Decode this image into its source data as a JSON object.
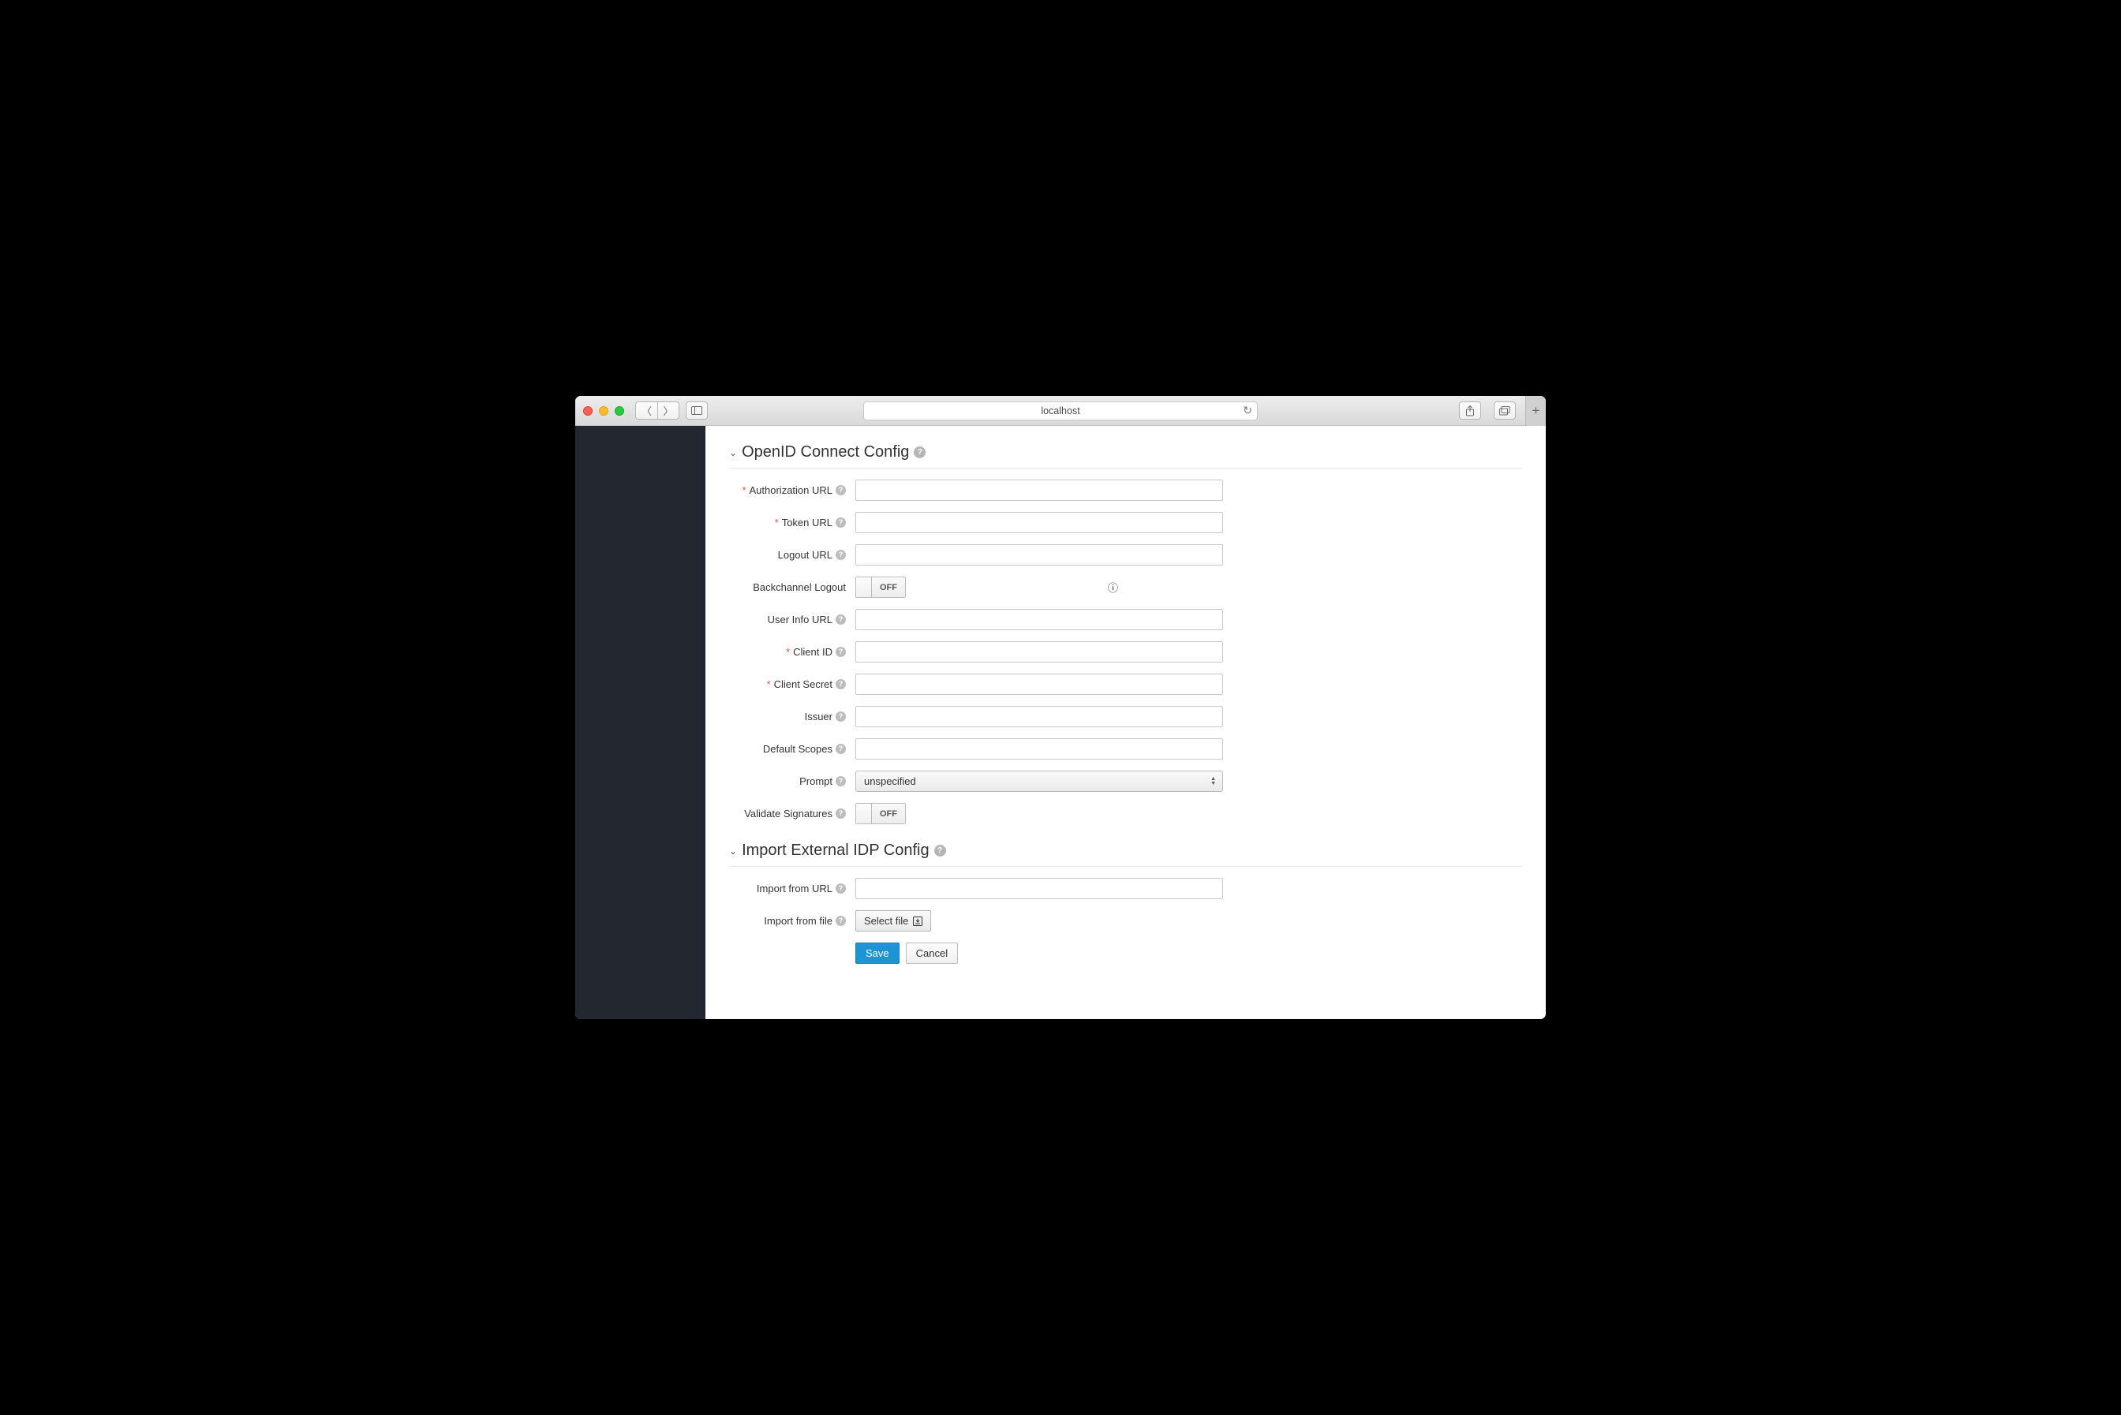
{
  "browser": {
    "address": "localhost"
  },
  "sections": {
    "openid": {
      "title": "OpenID Connect Config"
    },
    "import": {
      "title": "Import External IDP Config"
    }
  },
  "fields": {
    "authorization_url": {
      "label": "Authorization URL",
      "value": ""
    },
    "token_url": {
      "label": "Token URL",
      "value": ""
    },
    "logout_url": {
      "label": "Logout URL",
      "value": ""
    },
    "backchannel_logout": {
      "label": "Backchannel Logout",
      "toggle": "OFF"
    },
    "user_info_url": {
      "label": "User Info URL",
      "value": ""
    },
    "client_id": {
      "label": "Client ID",
      "value": ""
    },
    "client_secret": {
      "label": "Client Secret",
      "value": ""
    },
    "issuer": {
      "label": "Issuer",
      "value": ""
    },
    "default_scopes": {
      "label": "Default Scopes",
      "value": ""
    },
    "prompt": {
      "label": "Prompt",
      "selected": "unspecified"
    },
    "validate_signatures": {
      "label": "Validate Signatures",
      "toggle": "OFF"
    },
    "import_from_url": {
      "label": "Import from URL",
      "value": ""
    },
    "import_from_file": {
      "label": "Import from file",
      "button": "Select file"
    }
  },
  "buttons": {
    "save": "Save",
    "cancel": "Cancel"
  }
}
